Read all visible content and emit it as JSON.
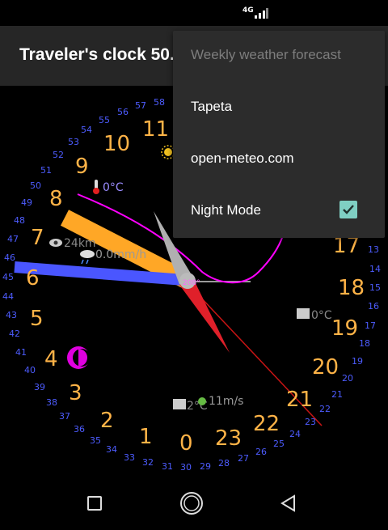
{
  "status": {
    "network": "4G"
  },
  "app": {
    "title": "Traveler's clock 50."
  },
  "menu": {
    "items": [
      {
        "label": "Weekly weather forecast",
        "enabled": false
      },
      {
        "label": "Tapeta",
        "enabled": true
      },
      {
        "label": "open-meteo.com",
        "enabled": true
      },
      {
        "label": "Night Mode",
        "enabled": true,
        "checked": true
      }
    ]
  },
  "clock": {
    "hours": [
      "0",
      "1",
      "2",
      "3",
      "4",
      "5",
      "6",
      "7",
      "8",
      "9",
      "10",
      "11",
      "17",
      "18",
      "19",
      "20",
      "21",
      "22",
      "23"
    ],
    "minutes": [
      "58",
      "57",
      "56",
      "55",
      "54",
      "53",
      "52",
      "51",
      "50",
      "49",
      "48",
      "47",
      "46",
      "45",
      "44",
      "43",
      "42",
      "41",
      "40",
      "39",
      "38",
      "37",
      "36",
      "35",
      "34",
      "33",
      "32",
      "31",
      "30",
      "29",
      "28",
      "27",
      "26",
      "25",
      "24",
      "23",
      "22",
      "21",
      "20",
      "19",
      "18",
      "17",
      "16",
      "15",
      "14",
      "13"
    ],
    "temperature_current": "0°C",
    "visibility": "24km",
    "precipitation": "0.0mm/h",
    "heading": "208°",
    "temperature_right": "0°C",
    "temperature_bottom": "2°C",
    "wind": "11m/s"
  },
  "colors": {
    "hour_numbers": "#ffb347",
    "minute_numbers": "#4d5cff",
    "hour_hand": "#ffa726",
    "minute_hand": "#4a56ff",
    "needle_red": "#e0202a",
    "needle_gray": "#b0b0b0",
    "curve": "#ff00ff",
    "moon": "#e000e0",
    "checkbox": "#7fcfc3"
  }
}
